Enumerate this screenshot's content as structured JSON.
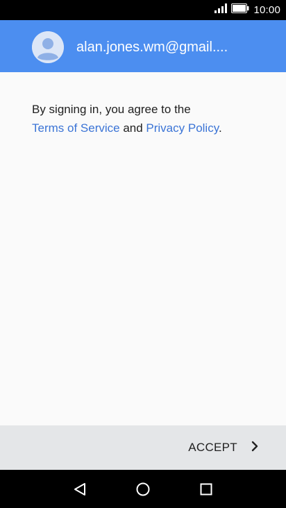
{
  "status_bar": {
    "time": "10:00",
    "signal_icon": "signal-icon",
    "battery_icon": "battery-icon"
  },
  "header": {
    "email": "alan.jones.wm@gmail....",
    "avatar_icon": "account-avatar-icon",
    "color": "#4c8ef0"
  },
  "terms": {
    "prefix": "By signing in, you agree to the",
    "terms_link": "Terms of Service",
    "and": " and ",
    "privacy_link": "Privacy Policy",
    "suffix": "."
  },
  "footer": {
    "accept_label": "ACCEPT",
    "accept_icon": "chevron-right-icon"
  },
  "nav": {
    "back_icon": "back-icon",
    "home_icon": "home-icon",
    "recents_icon": "recents-icon"
  },
  "colors": {
    "link": "#3b74d6",
    "status_bar": "#000000",
    "footer": "#e4e6e8"
  }
}
